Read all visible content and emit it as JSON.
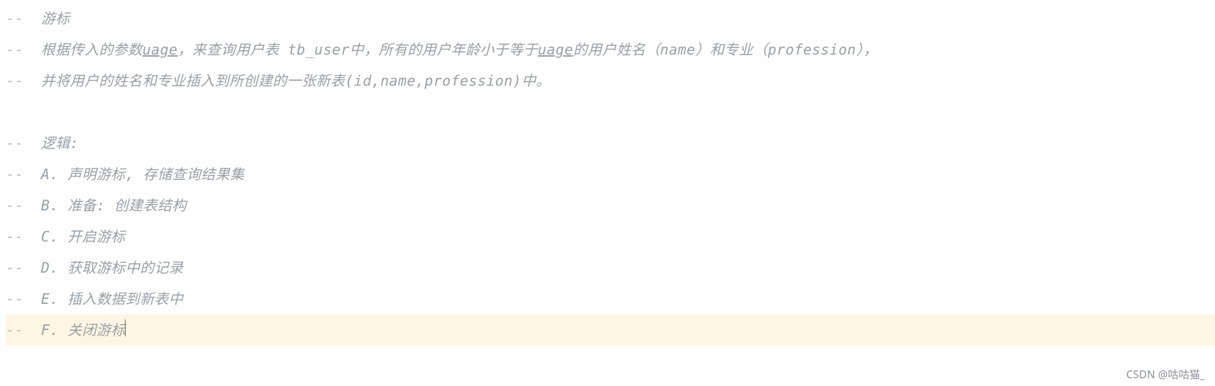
{
  "comment_prefix": "--",
  "lines": [
    "游标",
    "根据传入的参数uage，来查询用户表 tb_user中，所有的用户年龄小于等于uage的用户姓名（name）和专业（profession），",
    "并将用户的姓名和专业插入到所创建的一张新表(id,name,profession)中。",
    "",
    "逻辑:",
    "A. 声明游标, 存储查询结果集",
    "B. 准备: 创建表结构",
    "C. 开启游标",
    "D. 获取游标中的记录",
    "E. 插入数据到新表中",
    "F. 关闭游标"
  ],
  "underline_words": [
    "uage",
    "uage"
  ],
  "active_line_index": 10,
  "watermark": "CSDN @咕咕猫_"
}
